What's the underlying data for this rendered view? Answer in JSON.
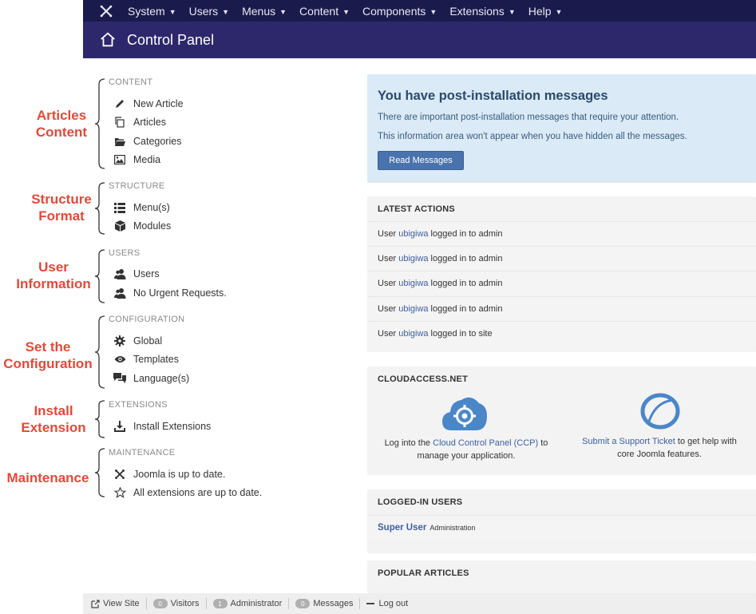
{
  "topnav": {
    "menus": [
      "System",
      "Users",
      "Menus",
      "Content",
      "Components",
      "Extensions",
      "Help"
    ]
  },
  "header": {
    "title": "Control Panel"
  },
  "annotations": {
    "articles": [
      "Articles",
      "Content"
    ],
    "structure": [
      "Structure",
      "Format"
    ],
    "users": [
      "User",
      "Information"
    ],
    "config": [
      "Set the",
      "Configuration"
    ],
    "install": [
      "Install",
      "Extension"
    ],
    "maintenance": [
      "Maintenance"
    ]
  },
  "sidebar": {
    "content": {
      "title": "CONTENT",
      "items": [
        "New Article",
        "Articles",
        "Categories",
        "Media"
      ]
    },
    "structure": {
      "title": "STRUCTURE",
      "items": [
        "Menu(s)",
        "Modules"
      ]
    },
    "users": {
      "title": "USERS",
      "items": [
        "Users",
        "No Urgent Requests."
      ]
    },
    "configuration": {
      "title": "CONFIGURATION",
      "items": [
        "Global",
        "Templates",
        "Language(s)"
      ]
    },
    "extensions": {
      "title": "EXTENSIONS",
      "items": [
        "Install Extensions"
      ]
    },
    "maintenance": {
      "title": "MAINTENANCE",
      "items": [
        "Joomla is up to date.",
        "All extensions are up to date."
      ]
    }
  },
  "postinstall": {
    "title": "You have post-installation messages",
    "line1": "There are important post-installation messages that require your attention.",
    "line2": "This information area won't appear when you have hidden all the messages.",
    "button": "Read Messages"
  },
  "latest_actions": {
    "title": "LATEST ACTIONS",
    "rows": [
      {
        "prefix": "User",
        "user": "ubigiwa",
        "suffix": "logged in to admin"
      },
      {
        "prefix": "User",
        "user": "ubigiwa",
        "suffix": "logged in to admin"
      },
      {
        "prefix": "User",
        "user": "ubigiwa",
        "suffix": "logged in to admin"
      },
      {
        "prefix": "User",
        "user": "ubigiwa",
        "suffix": "logged in to admin"
      },
      {
        "prefix": "User",
        "user": "ubigiwa",
        "suffix": "logged in to site"
      }
    ]
  },
  "cloudaccess": {
    "title": "CLOUDACCESS.NET",
    "left": {
      "pre": "Log into the",
      "link": "Cloud Control Panel (CCP)",
      "post": "to",
      "line2": "manage your application."
    },
    "right": {
      "link": "Submit a Support Ticket",
      "post": "to get help with",
      "line2": "core Joomla features."
    }
  },
  "logged_in": {
    "title": "LOGGED-IN USERS",
    "name": "Super User",
    "role": "Administration"
  },
  "popular": {
    "title": "POPULAR ARTICLES"
  },
  "statusbar": {
    "view_site": "View Site",
    "visitors_count": "0",
    "visitors": "Visitors",
    "admin_count": "1",
    "administrator": "Administrator",
    "messages_count": "0",
    "messages": "Messages",
    "logout": "Log out"
  },
  "colors": {
    "topnav": "#1b1a4d",
    "header": "#2d286b",
    "annotation": "#e04a3a",
    "link": "#3e5fa0",
    "alert_bg": "#daeaf6",
    "cloud_blue": "#4a87c7"
  }
}
